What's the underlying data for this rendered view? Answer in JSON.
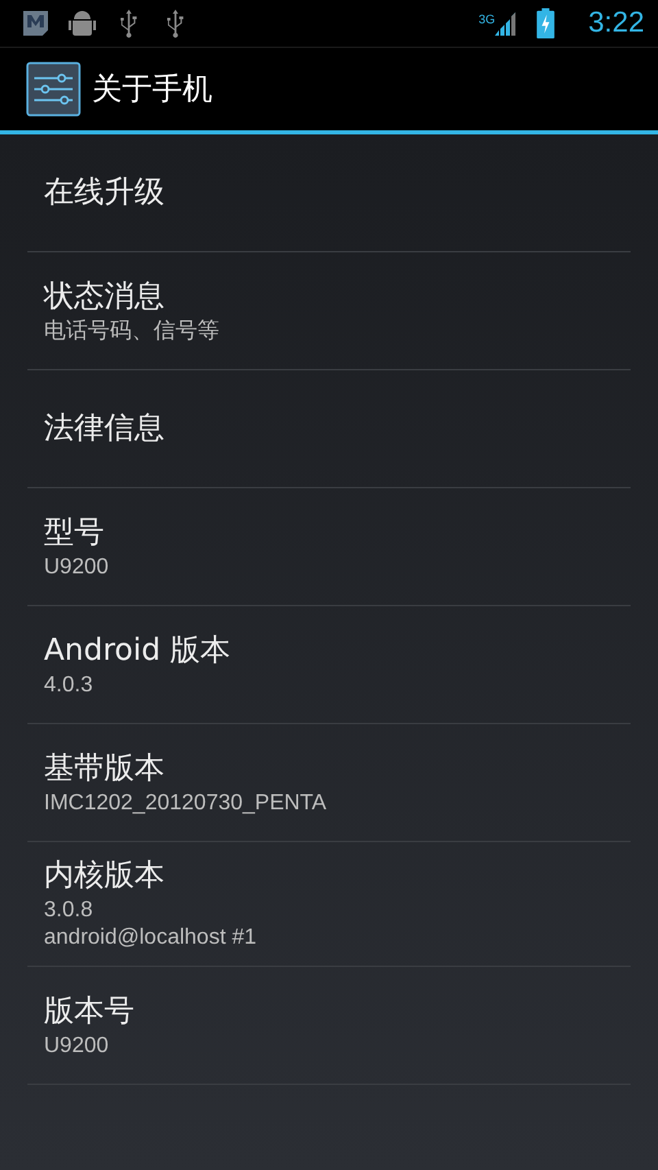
{
  "status_bar": {
    "network_type": "3G",
    "time": "3:22"
  },
  "action_bar": {
    "title": "关于手机"
  },
  "items": [
    {
      "title": "在线升级"
    },
    {
      "title": "状态消息",
      "summary": [
        "电话号码、信号等"
      ]
    },
    {
      "title": "法律信息"
    },
    {
      "title": "型号",
      "summary": [
        "U9200"
      ]
    },
    {
      "title": "Android 版本",
      "summary": [
        "4.0.3"
      ]
    },
    {
      "title": "基带版本",
      "summary": [
        "IMC1202_20120730_PENTA"
      ]
    },
    {
      "title": "内核版本",
      "summary": [
        "3.0.8",
        "android@localhost #1"
      ]
    },
    {
      "title": "版本号",
      "summary": [
        "U9200"
      ]
    }
  ]
}
